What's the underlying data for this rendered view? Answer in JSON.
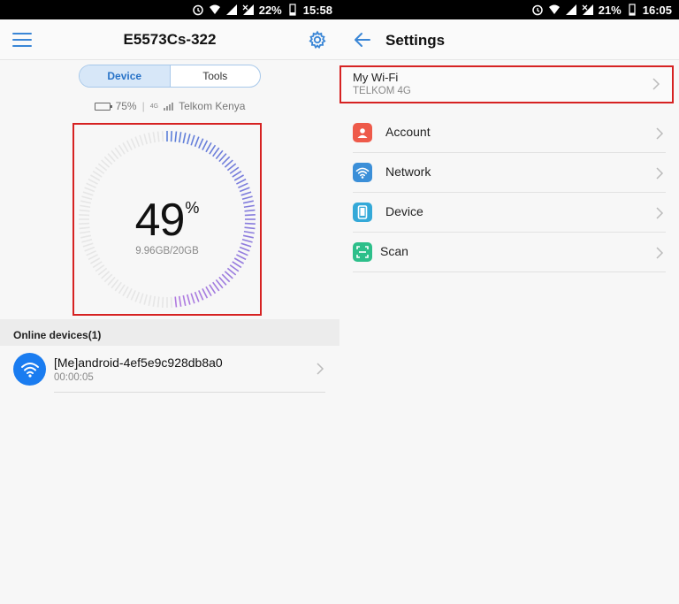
{
  "left": {
    "status_bar": {
      "battery": "22%",
      "time": "15:58"
    },
    "app_title": "E5573Cs-322",
    "tabs": [
      {
        "label": "Device",
        "active": true
      },
      {
        "label": "Tools",
        "active": false
      }
    ],
    "status": {
      "battery": "75%",
      "network_type": "4G",
      "carrier": "Telkom Kenya"
    },
    "gauge": {
      "value": "49",
      "unit": "%",
      "usage": "9.96GB/20GB"
    },
    "online_section": "Online devices(1)",
    "devices": [
      {
        "name": "[Me]android-4ef5e9c928db8a0",
        "duration": "00:00:05"
      }
    ]
  },
  "right": {
    "status_bar": {
      "battery": "21%",
      "time": "16:05"
    },
    "title": "Settings",
    "wifi": {
      "title": "My Wi-Fi",
      "subtitle": "TELKOM 4G"
    },
    "menu": [
      {
        "label": "Account",
        "icon": "account-icon",
        "color": "#ee5a4a"
      },
      {
        "label": "Network",
        "icon": "wifi-icon",
        "color": "#3b8fd8"
      },
      {
        "label": "Device",
        "icon": "phone-icon",
        "color": "#34a9d8"
      },
      {
        "label": "Scan",
        "icon": "scan-icon",
        "color": "#2dbf8a"
      }
    ]
  },
  "colors": {
    "accent": "#2a74c8",
    "highlight": "#d62222",
    "gauge_blue": "#5b7fd9",
    "gauge_purple": "#b07ae0"
  }
}
